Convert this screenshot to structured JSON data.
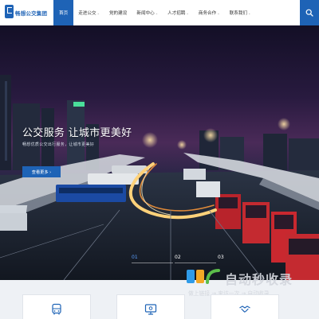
{
  "header": {
    "logo_text": "畅想公交集团",
    "nav": [
      {
        "label": "首页",
        "active": true,
        "dropdown": false
      },
      {
        "label": "走进公交",
        "active": false,
        "dropdown": true
      },
      {
        "label": "党的建设",
        "active": false,
        "dropdown": false
      },
      {
        "label": "新闻中心",
        "active": false,
        "dropdown": true
      },
      {
        "label": "人才招聘",
        "active": false,
        "dropdown": true
      },
      {
        "label": "商务合作",
        "active": false,
        "dropdown": true
      },
      {
        "label": "联系我们",
        "active": false,
        "dropdown": true
      }
    ],
    "chevron_glyph": "⌄",
    "search_icon": "search-icon"
  },
  "hero": {
    "headline": "公交服务 让城市更美好",
    "subtitle": "畅想优质公交出行服务，让城市更美好",
    "button_label": "查看更多 ›",
    "slides": [
      "01",
      "02",
      "03"
    ],
    "active_slide": 0
  },
  "watermark": {
    "title": "自动秒收录",
    "tagline": "做上链接 → 来访一次 → 自动收录"
  },
  "cards": [
    {
      "icon": "bus-icon"
    },
    {
      "icon": "monitor-icon"
    },
    {
      "icon": "handshake-icon"
    }
  ],
  "colors": {
    "brand": "#1e63b6",
    "accent_light": "#ffd27a"
  }
}
